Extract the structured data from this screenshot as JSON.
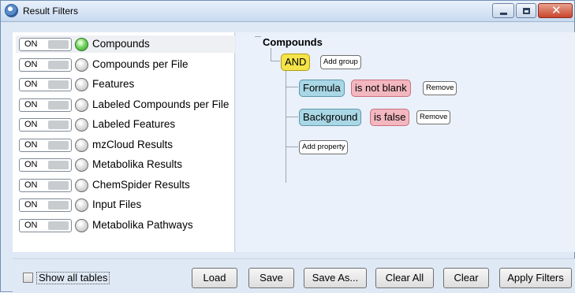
{
  "window": {
    "title": "Result Filters"
  },
  "tables": [
    {
      "toggle": "ON",
      "label": "Compounds",
      "status": "green"
    },
    {
      "toggle": "ON",
      "label": "Compounds per File",
      "status": "gray"
    },
    {
      "toggle": "ON",
      "label": "Features",
      "status": "gray"
    },
    {
      "toggle": "ON",
      "label": "Labeled Compounds per File",
      "status": "gray"
    },
    {
      "toggle": "ON",
      "label": "Labeled Features",
      "status": "gray"
    },
    {
      "toggle": "ON",
      "label": "mzCloud Results",
      "status": "gray"
    },
    {
      "toggle": "ON",
      "label": "Metabolika Results",
      "status": "gray"
    },
    {
      "toggle": "ON",
      "label": "ChemSpider Results",
      "status": "gray"
    },
    {
      "toggle": "ON",
      "label": "Input Files",
      "status": "gray"
    },
    {
      "toggle": "ON",
      "label": "Metabolika Pathways",
      "status": "gray"
    }
  ],
  "filter_tree": {
    "root": "Compounds",
    "operator": "AND",
    "add_group": "Add group",
    "conditions": [
      {
        "property": "Formula",
        "condition": "is not blank",
        "remove": "Remove"
      },
      {
        "property": "Background",
        "condition": "is false",
        "remove": "Remove"
      }
    ],
    "add_property": "Add property"
  },
  "footer": {
    "show_all_tables": "Show all tables",
    "buttons": {
      "load": "Load",
      "save": "Save",
      "save_as": "Save As...",
      "clear_all": "Clear All",
      "clear": "Clear",
      "apply": "Apply Filters"
    }
  },
  "colors": {
    "status_green": "#3aa12c",
    "operator_yellow": "#f4e44a",
    "property_blue": "#a9d7e5",
    "condition_pink": "#f3b7c0"
  }
}
